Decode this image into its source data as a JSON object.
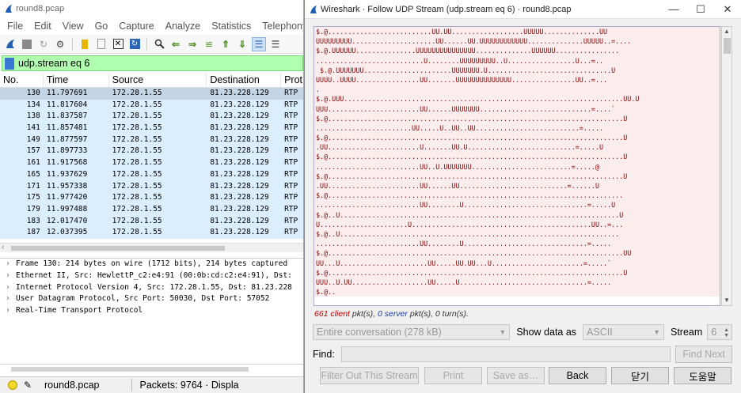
{
  "main": {
    "title": "round8.pcap",
    "menu": [
      "File",
      "Edit",
      "View",
      "Go",
      "Capture",
      "Analyze",
      "Statistics",
      "Telephony"
    ],
    "filter_text": "udp.stream eq 6",
    "columns": [
      "No.",
      "Time",
      "Source",
      "Destination",
      "Prot"
    ],
    "packets": [
      {
        "no": "130",
        "time": "11.797691",
        "src": "172.28.1.55",
        "dst": "81.23.228.129",
        "proto": "RTP"
      },
      {
        "no": "134",
        "time": "11.817604",
        "src": "172.28.1.55",
        "dst": "81.23.228.129",
        "proto": "RTP"
      },
      {
        "no": "138",
        "time": "11.837587",
        "src": "172.28.1.55",
        "dst": "81.23.228.129",
        "proto": "RTP"
      },
      {
        "no": "141",
        "time": "11.857481",
        "src": "172.28.1.55",
        "dst": "81.23.228.129",
        "proto": "RTP"
      },
      {
        "no": "149",
        "time": "11.877597",
        "src": "172.28.1.55",
        "dst": "81.23.228.129",
        "proto": "RTP"
      },
      {
        "no": "157",
        "time": "11.897733",
        "src": "172.28.1.55",
        "dst": "81.23.228.129",
        "proto": "RTP"
      },
      {
        "no": "161",
        "time": "11.917568",
        "src": "172.28.1.55",
        "dst": "81.23.228.129",
        "proto": "RTP"
      },
      {
        "no": "165",
        "time": "11.937629",
        "src": "172.28.1.55",
        "dst": "81.23.228.129",
        "proto": "RTP"
      },
      {
        "no": "171",
        "time": "11.957338",
        "src": "172.28.1.55",
        "dst": "81.23.228.129",
        "proto": "RTP"
      },
      {
        "no": "175",
        "time": "11.977420",
        "src": "172.28.1.55",
        "dst": "81.23.228.129",
        "proto": "RTP"
      },
      {
        "no": "179",
        "time": "11.997488",
        "src": "172.28.1.55",
        "dst": "81.23.228.129",
        "proto": "RTP"
      },
      {
        "no": "183",
        "time": "12.017470",
        "src": "172.28.1.55",
        "dst": "81.23.228.129",
        "proto": "RTP"
      },
      {
        "no": "187",
        "time": "12.037395",
        "src": "172.28.1.55",
        "dst": "81.23.228.129",
        "proto": "RTP"
      }
    ],
    "details": [
      "Frame 130: 214 bytes on wire (1712 bits), 214 bytes captured",
      "Ethernet II, Src: HewlettP_c2:e4:91 (00:0b:cd:c2:e4:91), Dst:",
      "Internet Protocol Version 4, Src: 172.28.1.55, Dst: 81.23.228",
      "User Datagram Protocol, Src Port: 50030, Dst Port: 57052",
      "Real-Time Transport Protocol"
    ],
    "status": {
      "file": "round8.pcap",
      "packets": "Packets: 9764 · Displa"
    }
  },
  "dialog": {
    "title": "Wireshark · Follow UDP Stream (udp.stream eq 6) · round8.pcap",
    "stream_lines": [
      "$.@..........................UU.UU..................UUUUU..............UU",
      "UUUUUUUUU.....................UU......UU.UUUUUUUUUUUU..............UUUUU..=....",
      "$.@.UUUUUU...............UUUUUUUUUUUUUUU..............UUUUUU................",
      "...........................U........UUUUUUUUU..U.................U...=..",
      " $.@.UUUUUUU......................UUUUUUU.U...............................U",
      "UUUU..UUUU................UU.......UUUUUUUUUUUUUU................UU..=...",
      ".",
      "$.@.UUU......................................................................UU.U",
      "UUU.......................UU......UUUUUUU............................=....`",
      "$.@..........................................................................U",
      "........................UU.....U..UU..UU..........................=.....",
      "$.@..........................................................................U",
      ".UU.......................U.......UU.U...........................=.....U",
      "$.@..........................................................................U",
      "..........................UU..U.UUUUUUU.........................=.....@",
      "$.@..........................................................................U",
      ".UU.......................UU......UU...........................=......U",
      "$.@..........................................................................",
      "..........................UU........U...............................=.....U",
      "$.@..U......................................................................U",
      "U......................U.............................................UU..=...",
      "$.@..U......................................................................",
      "..........................UU........U...............................=.....",
      "$.@..........................................................................UU",
      "UU...U......................UU.....UU.UU...U.......................=.....`",
      "$.@..........................................................................U",
      "UUU..U.UU...................UU.....U................................=.....",
      "$.@.."
    ],
    "summary_client": "661 client",
    "summary_rest_a": " pkt(s), ",
    "summary_server": "0 server",
    "summary_rest_b": " pkt(s), 0 turn(s).",
    "conversation": "Entire conversation (278 kB)",
    "show_data_as_label": "Show data as",
    "show_data_as": "ASCII",
    "stream_label": "Stream",
    "stream_value": "6",
    "find_label": "Find:",
    "find_next": "Find Next",
    "buttons": {
      "filter_out": "Filter Out This Stream",
      "print": "Print",
      "save_as": "Save as…",
      "back": "Back",
      "close": "닫기",
      "help": "도움말"
    }
  }
}
